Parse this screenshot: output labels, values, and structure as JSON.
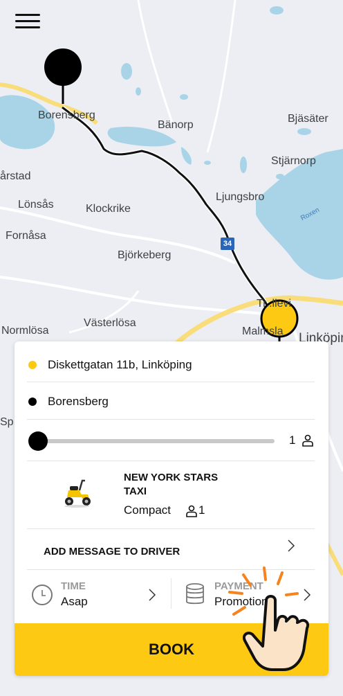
{
  "map": {
    "places": [
      "Borensberg",
      "Bänorp",
      "Bjäsäter",
      "Stjärnorp",
      "årstad",
      "Lönsås",
      "Klockrike",
      "Ljungsbro",
      "Fornåsa",
      "Björkeberg",
      "Roxen",
      "Normlösa",
      "Västerlösa",
      "Tr..llevi",
      "Malmsla",
      "Linköpin",
      "Sp"
    ],
    "road_number": "34"
  },
  "menu": {
    "icon": "hamburger-menu-icon"
  },
  "route": {
    "pickup": "Diskettgatan 11b, Linköping",
    "dropoff": "Borensberg",
    "pickup_color": "#fdc912",
    "dropoff_color": "#000000"
  },
  "passengers": {
    "count": "1",
    "icon": "person-icon",
    "level": 0.0
  },
  "vehicle": {
    "name": "NEW YORK STARS TAXI",
    "class": "Compact",
    "seats": "1",
    "icon": "yellow-scooter-icon"
  },
  "message": {
    "label": "ADD MESSAGE TO DRIVER"
  },
  "time": {
    "label": "TIME",
    "value": "Asap",
    "icon": "clock-icon"
  },
  "payment": {
    "label": "PAYMENT",
    "value": "Promotions",
    "icon": "coin-stack-icon"
  },
  "book": {
    "label": "BOOK",
    "color": "#fdc912"
  },
  "overlay": {
    "icon": "tap-hand-icon",
    "accent": "#f5841f"
  }
}
